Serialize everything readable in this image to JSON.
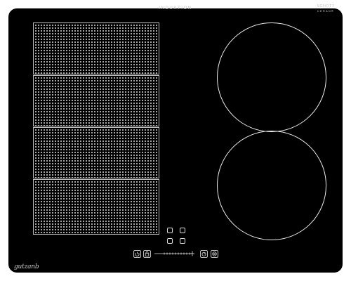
{
  "appliance": {
    "type_label": "INDUKTION",
    "glass_brand_line1": "SCHOTT",
    "glass_brand_line2": "CERAN®",
    "maker_logo": "gutzanb"
  },
  "cooking_zones": {
    "flex_zones": [
      "flex-zone-1",
      "flex-zone-2",
      "flex-zone-3",
      "flex-zone-4"
    ],
    "round_zones": [
      "round-zone-rear-right",
      "round-zone-front-right"
    ]
  },
  "controls": {
    "zone_select_keys": [
      "zone-select-1",
      "zone-select-2",
      "zone-select-3",
      "zone-select-4"
    ],
    "icons": [
      "power-icon",
      "lock-icon",
      "timer-icon",
      "boost-icon"
    ],
    "slider": "power-level-slider"
  },
  "colors": {
    "glass": "#000000",
    "markings": "#dcdcdc",
    "background": "#ffffff"
  }
}
